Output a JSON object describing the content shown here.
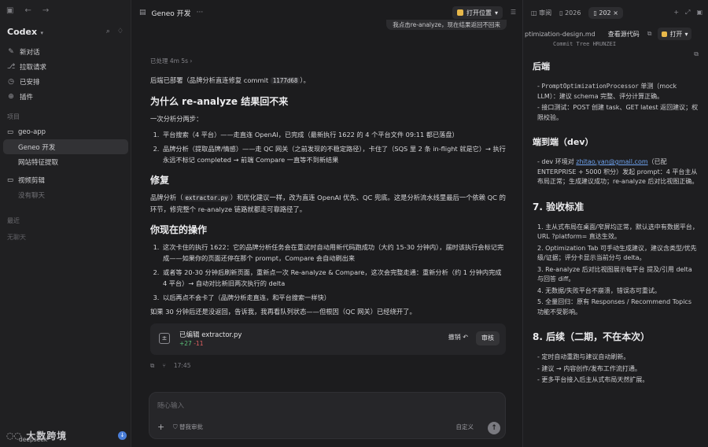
{
  "sidebar": {
    "brand": "Codex",
    "nav": [
      {
        "icon": "new-chat-icon",
        "label": "新对话"
      },
      {
        "icon": "pull-request-icon",
        "label": "拉取请求"
      },
      {
        "icon": "schedule-icon",
        "label": "已安排"
      },
      {
        "icon": "plugin-icon",
        "label": "插件"
      }
    ],
    "projects_label": "项目",
    "projects": [
      {
        "label": "geo-app",
        "type": "folder"
      },
      {
        "label": "Geneo 开发",
        "type": "chat",
        "active": true
      },
      {
        "label": "网站特征提取",
        "type": "chat"
      },
      {
        "label": "视频剪辑",
        "type": "folder"
      },
      {
        "label": "没有聊天",
        "type": "empty"
      }
    ],
    "recent_label": "最近",
    "recent_empty": "无聊天",
    "footer_logo": "大数跨境",
    "footer_user": "deepseek",
    "footer_badge": "↓"
  },
  "main": {
    "title": "Geneo 开发",
    "more": "···",
    "open_location": "打开位置",
    "user_message": "我点击re-analyze，现在结果返回不回来",
    "processed": "已处理 4m 5s",
    "deploy_prefix": "后端已部署（品牌分析直连修复 commit ",
    "deploy_commit": "1177d68",
    "deploy_suffix": "）。",
    "h_why": "为什么 re-analyze 结果回不来",
    "why_intro": "一次分析分两步：",
    "why_steps": [
      "平台搜索（4 平台）——走直连 OpenAI，已完成（最新执行 1622 的 4 个平台文件 09:11 都已落盘）",
      "品牌分析（提取品牌/情感）——走 QC 网关（之前发现的不稳定路径），卡住了（SQS 里 2 条 in-flight 就是它）→ 执行永远不标记 completed → 前端 Compare 一直等不到新结果"
    ],
    "h_fix": "修复",
    "fix_prefix": "品牌分析（",
    "fix_code": "extractor.py",
    "fix_suffix": "）和优化建议一样，改为直连 OpenAI 优先、QC 兜底。这是分析流水线里最后一个依赖 QC 的环节，修完整个 re-analyze 链路就都走可靠路径了。",
    "h_now": "你现在的操作",
    "now_steps": [
      "这次卡住的执行 1622：它的品牌分析任务会在重试时自动用新代码跑成功（大约 15-30 分钟内），届时该执行会标记完成——如果你的页面还停在那个 prompt，Compare 会自动刷出来",
      "或者等 20-30 分钟后刷新页面，重新点一次 Re-analyze & Compare，这次会完整走通：重新分析（约 1 分钟内完成 4 平台）→ 自动对比新旧两次执行的 delta",
      "以后再点不会卡了（品牌分析走直连，和平台搜索一样快）"
    ],
    "closing": "如果 30 分钟后还是没返回，告诉我，我再看队列状态——但根因（QC 网关）已经绕开了。",
    "edit_title": "已编辑 extractor.py",
    "edit_added": "+27",
    "edit_removed": "-11",
    "undo": "撤销",
    "review": "审核",
    "time": "17:45",
    "composer_placeholder": "随心输入",
    "composer_perm": "替我审批",
    "composer_model": "自定义"
  },
  "right": {
    "tabs": [
      "审阅",
      "2026",
      "202"
    ],
    "file_name": "ptimization-design.md",
    "view_source": "查看源代码",
    "open": "打开",
    "cut_text": "Commit  Tree  HRUNZEI",
    "h_backend": "后端",
    "backend": [
      {
        "pre": "- ",
        "mono": "PromptOptimizationProcessor",
        "post": " 单测（mock LLM）：建议 schema 完整、评分计算正确。"
      },
      {
        "pre": "- 接口测试：POST 创建 task、GET latest 返回建议；权限校验。",
        "mono": "",
        "post": ""
      }
    ],
    "h_e2e": "端到端（dev）",
    "e2e_pre": "- dev 环境对 ",
    "e2e_link": "zhitao.yan@gmail.com",
    "e2e_post": "（已配 ENTERPRISE + 5000 积分）发起 prompt：4 平台主从布局正常；生成建议成功；re-analyze 后对比视图正确。",
    "h_acceptance": "7. 验收标准",
    "acceptance": [
      "1. 主从式布局在桌面/窄屏均正常，默认选中有数据平台，URL ?platform= 直达生效。",
      "2. Optimization Tab 可手动生成建议，建议含类型/优先级/证据；评分卡显示当前分与 delta。",
      "3. Re-analyze 后对比视图展示每平台 提及/引用 delta 与回答 diff。",
      "4. 无数据/失败平台不崩溃，错误态可重试。",
      "5. 全量回归：原有 Responses / Recommend Topics 功能不受影响。"
    ],
    "h_followup": "8. 后续（二期，不在本次）",
    "followup": [
      "- 定时自动重跑与建议自动刷新。",
      "- 建议 → 内容创作/发布工作流打通。",
      "- 更多平台接入后主从式布局天然扩展。"
    ]
  }
}
